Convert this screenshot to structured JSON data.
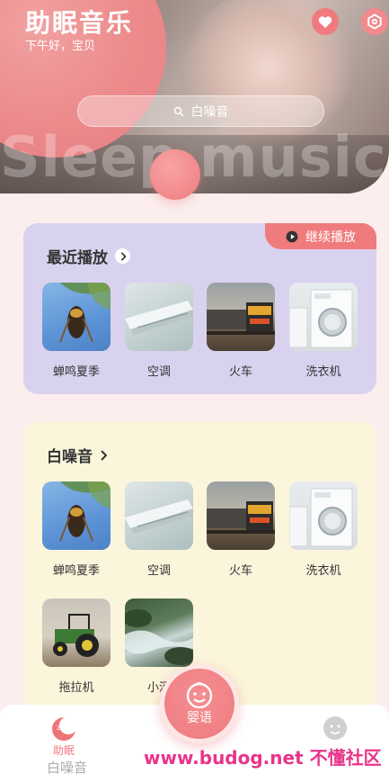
{
  "header": {
    "title": "助眠音乐",
    "subtitle": "下午好，宝贝",
    "watermark": "Sleep music",
    "search_placeholder": "白噪音"
  },
  "recent": {
    "title": "最近播放",
    "continue_label": "继续播放",
    "items": [
      {
        "label": "蝉鸣夏季",
        "thumb": "cicada"
      },
      {
        "label": "空调",
        "thumb": "air-conditioner"
      },
      {
        "label": "火车",
        "thumb": "train"
      },
      {
        "label": "洗衣机",
        "thumb": "washing-machine"
      }
    ]
  },
  "white_noise": {
    "title": "白噪音",
    "items": [
      {
        "label": "蝉鸣夏季",
        "thumb": "cicada"
      },
      {
        "label": "空调",
        "thumb": "air-conditioner"
      },
      {
        "label": "火车",
        "thumb": "train"
      },
      {
        "label": "洗衣机",
        "thumb": "washing-machine"
      },
      {
        "label": "拖拉机",
        "thumb": "tractor"
      },
      {
        "label": "小河",
        "thumb": "stream"
      }
    ]
  },
  "nav": {
    "sleep_label": "助眠",
    "center_label": "婴语",
    "peek_text": "白噪音"
  },
  "watermark_site": "www.budog.net 不懂社区",
  "colors": {
    "accent": "#f07a7d",
    "recent_card_bg": "#d9d2ef",
    "white_card_bg": "#fbf5dc",
    "page_bg": "#fbeeed"
  }
}
